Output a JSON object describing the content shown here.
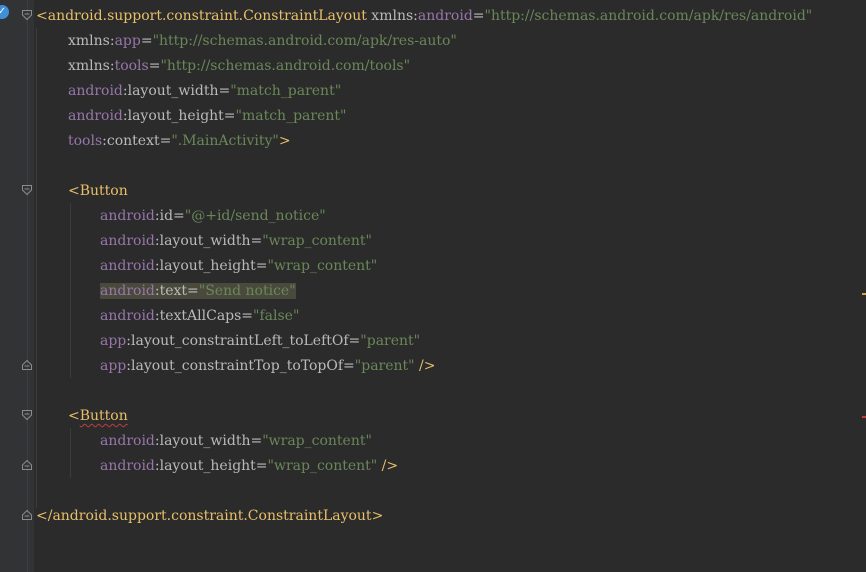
{
  "editor": {
    "lines": [
      [
        {
          "t": "<",
          "c": "tag"
        },
        {
          "t": "android.support.constraint.ConstraintLayout",
          "c": "tag"
        },
        {
          "t": " xmlns:",
          "c": "attr"
        },
        {
          "t": "android",
          "c": "ns"
        },
        {
          "t": "=",
          "c": "attr"
        },
        {
          "t": "\"http://schemas.android.com/apk/res/android\"",
          "c": "val"
        }
      ],
      [
        {
          "t": "xmlns:",
          "c": "attr"
        },
        {
          "t": "app",
          "c": "ns"
        },
        {
          "t": "=",
          "c": "attr"
        },
        {
          "t": "\"http://schemas.android.com/apk/res-auto\"",
          "c": "val"
        }
      ],
      [
        {
          "t": "xmlns:",
          "c": "attr"
        },
        {
          "t": "tools",
          "c": "ns"
        },
        {
          "t": "=",
          "c": "attr"
        },
        {
          "t": "\"http://schemas.android.com/tools\"",
          "c": "val"
        }
      ],
      [
        {
          "t": "android",
          "c": "ns"
        },
        {
          "t": ":layout_width=",
          "c": "attr"
        },
        {
          "t": "\"match_parent\"",
          "c": "val"
        }
      ],
      [
        {
          "t": "android",
          "c": "ns"
        },
        {
          "t": ":layout_height=",
          "c": "attr"
        },
        {
          "t": "\"match_parent\"",
          "c": "val"
        }
      ],
      [
        {
          "t": "tools",
          "c": "ns"
        },
        {
          "t": ":context=",
          "c": "attr"
        },
        {
          "t": "\".MainActivity\"",
          "c": "val"
        },
        {
          "t": ">",
          "c": "tag"
        }
      ],
      [],
      [
        {
          "t": "<Button",
          "c": "tag"
        }
      ],
      [
        {
          "t": "android",
          "c": "ns"
        },
        {
          "t": ":id=",
          "c": "attr"
        },
        {
          "t": "\"@+id/send_notice\"",
          "c": "val"
        }
      ],
      [
        {
          "t": "android",
          "c": "ns"
        },
        {
          "t": ":layout_width=",
          "c": "attr"
        },
        {
          "t": "\"wrap_content\"",
          "c": "val"
        }
      ],
      [
        {
          "t": "android",
          "c": "ns"
        },
        {
          "t": ":layout_height=",
          "c": "attr"
        },
        {
          "t": "\"wrap_content\"",
          "c": "val"
        }
      ],
      [
        {
          "t": "android",
          "c": "ns",
          "h": true
        },
        {
          "t": ":text=",
          "c": "attr",
          "h": true
        },
        {
          "t": "\"Send notice\"",
          "c": "val",
          "h": true
        }
      ],
      [
        {
          "t": "android",
          "c": "ns"
        },
        {
          "t": ":textAllCaps=",
          "c": "attr"
        },
        {
          "t": "\"false\"",
          "c": "val"
        }
      ],
      [
        {
          "t": "app",
          "c": "ns"
        },
        {
          "t": ":layout_constraintLeft_toLeftOf=",
          "c": "attr"
        },
        {
          "t": "\"parent\"",
          "c": "val"
        }
      ],
      [
        {
          "t": "app",
          "c": "ns"
        },
        {
          "t": ":layout_constraintTop_toTopOf=",
          "c": "attr"
        },
        {
          "t": "\"parent\"",
          "c": "val"
        },
        {
          "t": " />",
          "c": "tag"
        }
      ],
      [],
      [
        {
          "t": "<",
          "c": "tag"
        },
        {
          "t": "Button",
          "c": "tag",
          "sq": true
        }
      ],
      [
        {
          "t": "android",
          "c": "ns"
        },
        {
          "t": ":layout_width=",
          "c": "attr"
        },
        {
          "t": "\"wrap_content\"",
          "c": "val"
        }
      ],
      [
        {
          "t": "android",
          "c": "ns"
        },
        {
          "t": ":layout_height=",
          "c": "attr"
        },
        {
          "t": "\"wrap_content\"",
          "c": "val"
        },
        {
          "t": " />",
          "c": "tag"
        }
      ],
      [],
      [
        {
          "t": "</android.support.constraint.ConstraintLayout>",
          "c": "tag"
        }
      ]
    ]
  },
  "colors": {
    "background": "#2b2b2b",
    "gutter": "#313335",
    "tag": "#e8bf6a",
    "namespace": "#9876aa",
    "attribute": "#bababa",
    "value": "#6a8759",
    "highlight": "#4a4a3c",
    "error_stripe": "#bc3f3c",
    "warning_stripe": "#d9a343"
  },
  "icons": {
    "gutter_bulb": "intention-bulb-icon",
    "fold_open": "fold-open-icon",
    "fold_close": "fold-close-icon"
  }
}
